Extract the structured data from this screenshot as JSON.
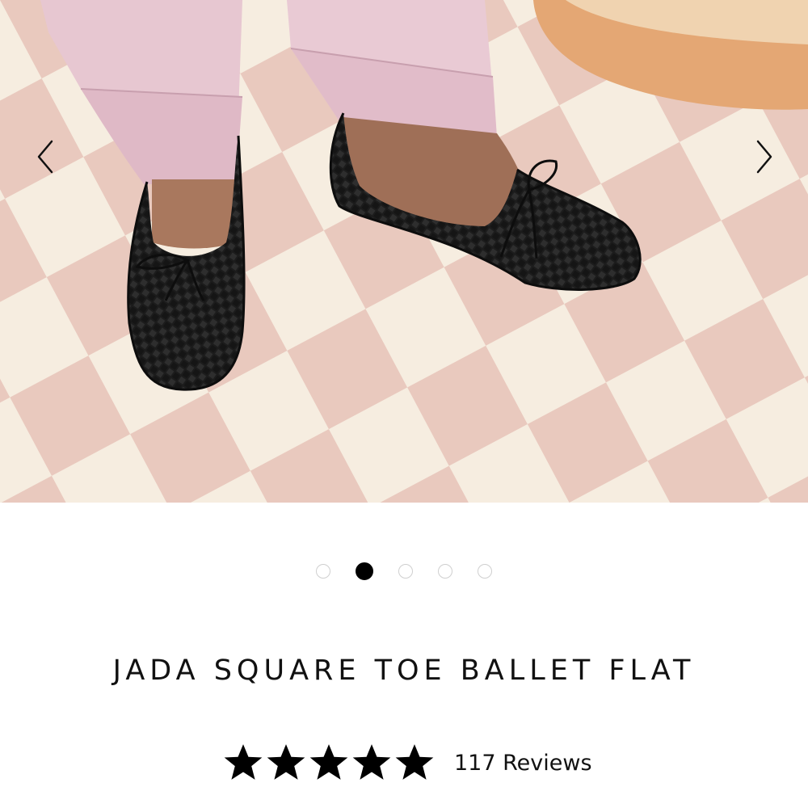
{
  "product": {
    "title": "JADA SQUARE TOE BALLET FLAT",
    "rating": 5,
    "rating_max": 5,
    "reviews_label": "117 Reviews"
  },
  "gallery": {
    "total_slides": 5,
    "active_slide": 2,
    "prev_icon": "chevron-left-icon",
    "next_icon": "chevron-right-icon"
  },
  "colors": {
    "accent": "#000000",
    "star": "#000000",
    "dot_inactive_border": "#cfcfcf",
    "rug_pink": "#e9c9be",
    "rug_cream": "#f6ede0",
    "pants_pink": "#e6c6d0",
    "shoe_black": "#1a1a1a"
  }
}
